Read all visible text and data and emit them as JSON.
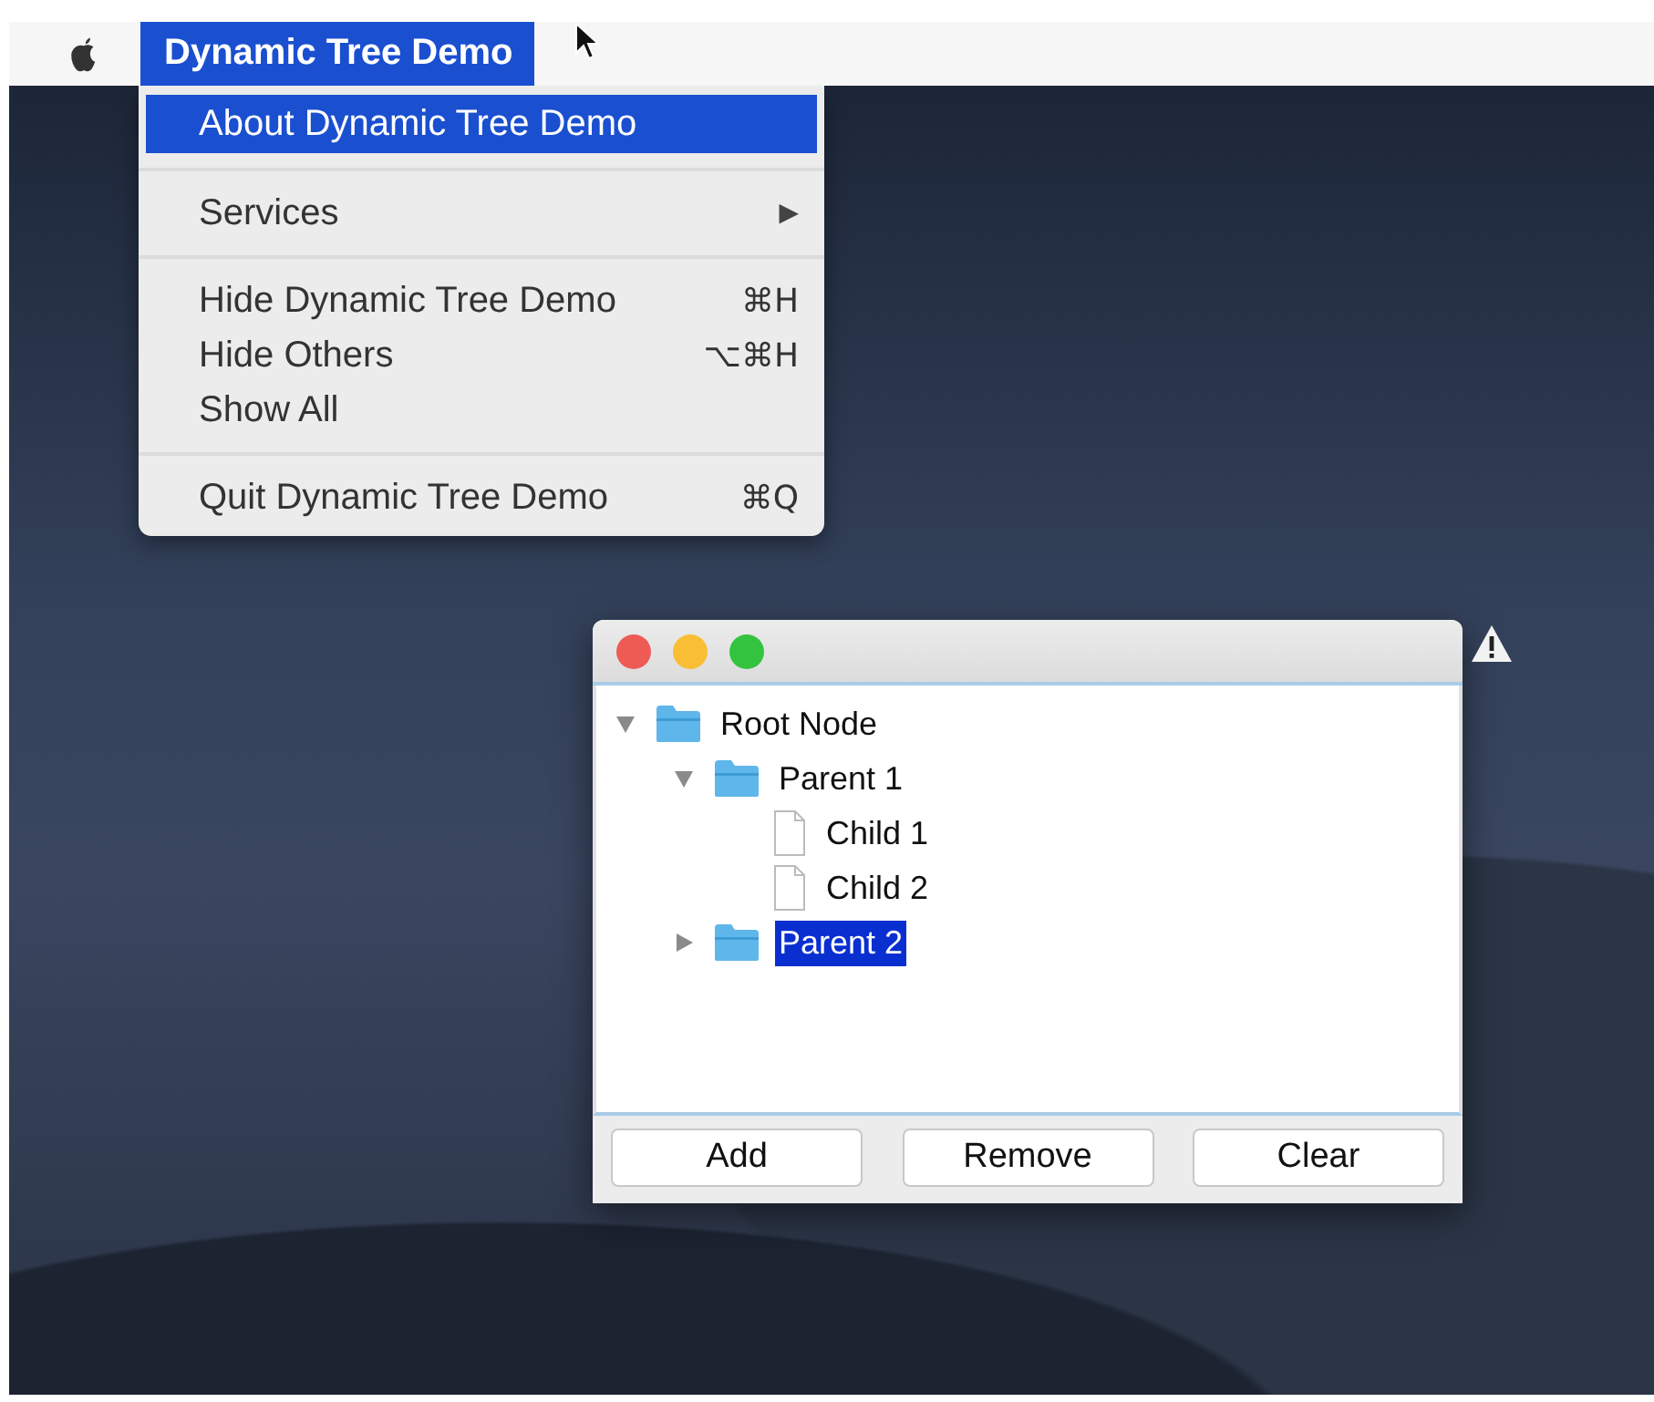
{
  "menu_bar": {
    "app_menu": {
      "label": "Dynamic Tree Demo",
      "selected": true
    }
  },
  "app_menu_dropdown": {
    "sections": [
      [
        {
          "label": "About Dynamic Tree Demo",
          "selected": true
        }
      ],
      [
        {
          "label": "Services",
          "selected": false,
          "submenu": true,
          "submenu_arrow": "▶"
        }
      ],
      [
        {
          "label": "Hide Dynamic Tree Demo",
          "selected": false,
          "shortcut": "⌘H"
        },
        {
          "label": "Hide Others",
          "selected": false,
          "shortcut": "⌥⌘H"
        },
        {
          "label": "Show All",
          "selected": false
        }
      ],
      [
        {
          "label": "Quit Dynamic Tree Demo",
          "selected": false,
          "shortcut": "⌘Q"
        }
      ]
    ]
  },
  "window": {
    "tree": [
      {
        "label": "Root Node",
        "kind": "folder",
        "expanded": true,
        "selected": false,
        "children": [
          {
            "label": "Parent 1",
            "kind": "folder",
            "expanded": true,
            "selected": false,
            "children": [
              {
                "label": "Child 1",
                "kind": "file",
                "selected": false
              },
              {
                "label": "Child 2",
                "kind": "file",
                "selected": false
              }
            ]
          },
          {
            "label": "Parent 2",
            "kind": "folder",
            "expanded": false,
            "selected": true
          }
        ]
      }
    ],
    "buttons": [
      "Add",
      "Remove",
      "Clear"
    ]
  }
}
